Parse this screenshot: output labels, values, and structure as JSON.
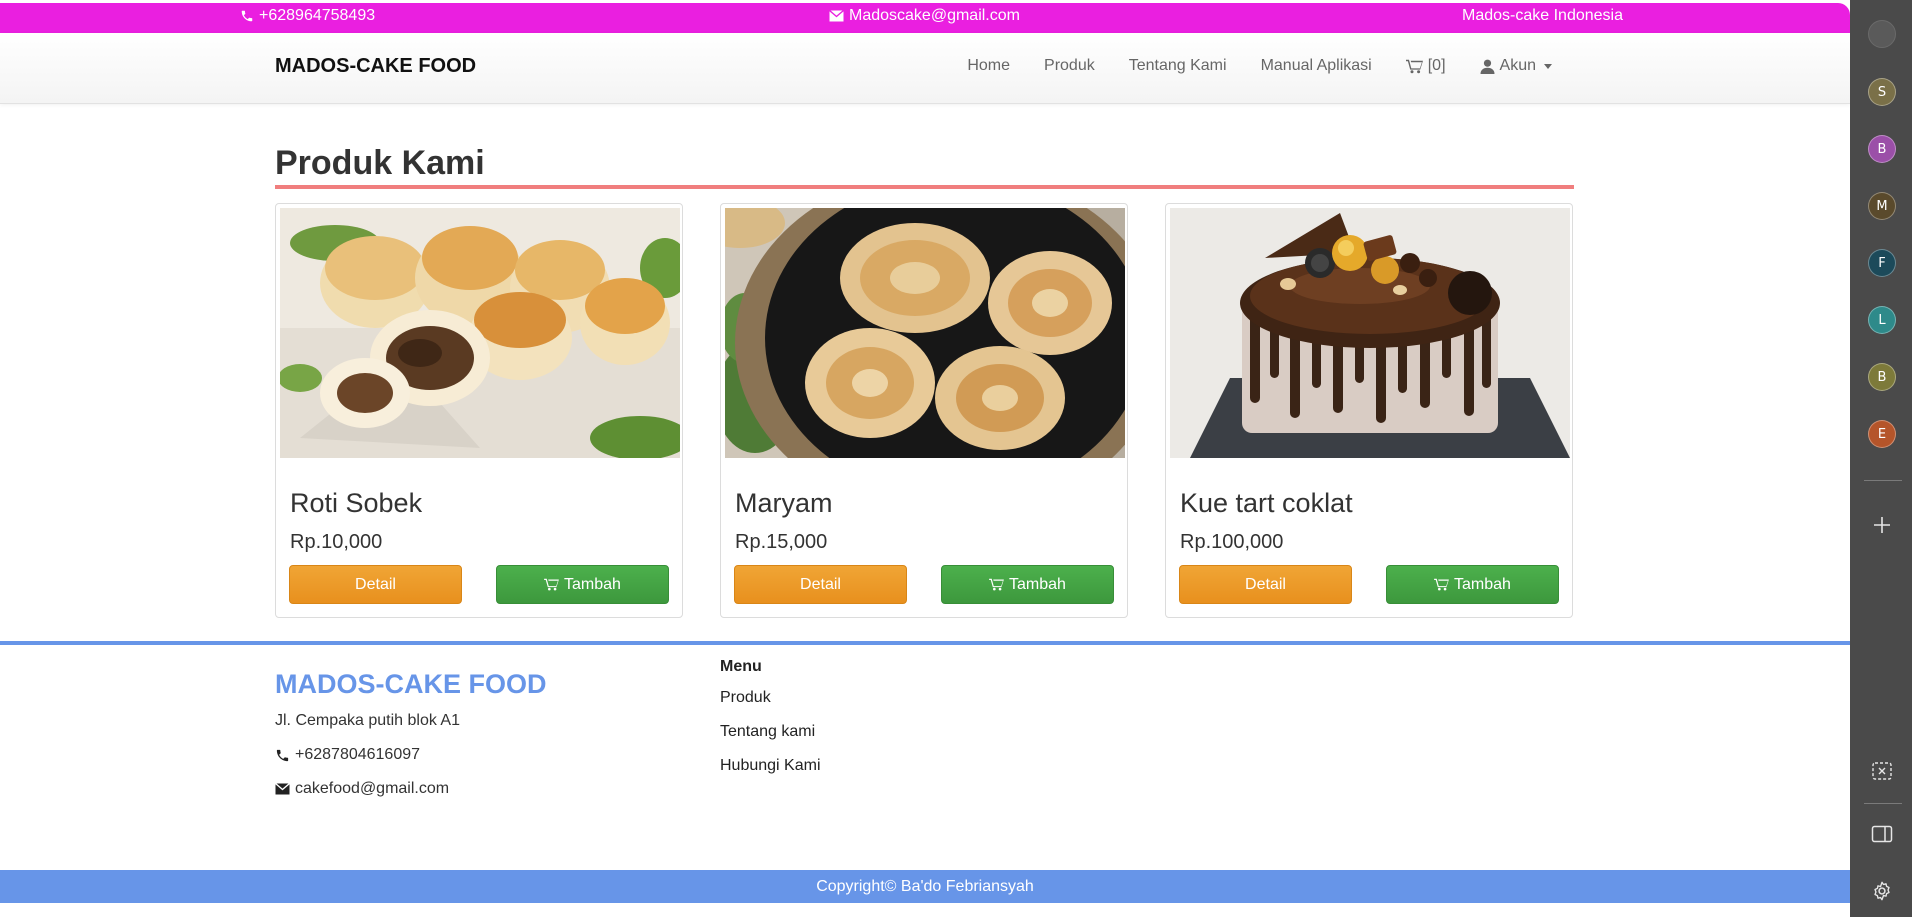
{
  "topbar": {
    "phone": "+628964758493",
    "email": "Madoscake@gmail.com",
    "tagline": "Mados-cake Indonesia"
  },
  "navbar": {
    "brand": "MADOS-CAKE FOOD",
    "links": [
      "Home",
      "Produk",
      "Tentang Kami",
      "Manual Aplikasi"
    ],
    "cart_count": "[0]",
    "account": "Akun"
  },
  "section": {
    "title": "Produk Kami"
  },
  "products": [
    {
      "name": "Roti Sobek",
      "price": "Rp.10,000",
      "detail_label": "Detail",
      "add_label": "Tambah"
    },
    {
      "name": "Maryam",
      "price": "Rp.15,000",
      "detail_label": "Detail",
      "add_label": "Tambah"
    },
    {
      "name": "Kue tart coklat",
      "price": "Rp.100,000",
      "detail_label": "Detail",
      "add_label": "Tambah"
    }
  ],
  "footer": {
    "brand": "MADOS-CAKE FOOD",
    "address": "Jl. Cempaka putih blok A1",
    "phone": "+6287804616097",
    "email": "cakefood@gmail.com",
    "menu_title": "Menu",
    "menu_items": [
      "Produk",
      "Tentang kami",
      "Hubungi Kami"
    ],
    "copyright": "Copyright© Ba'do Febriansyah"
  },
  "browser_sidebar": {
    "profiles": [
      {
        "letter": "S",
        "color": "#7a7048"
      },
      {
        "letter": "B",
        "color": "#9b4fa8"
      },
      {
        "letter": "M",
        "color": "#5a4a2c"
      },
      {
        "letter": "F",
        "color": "#1c4a5a"
      },
      {
        "letter": "L",
        "color": "#2e8a8a"
      },
      {
        "letter": "B",
        "color": "#7d7a3a"
      },
      {
        "letter": "E",
        "color": "#b5552a"
      }
    ],
    "icons": [
      "add-icon",
      "screenshot-icon",
      "panel-icon",
      "settings-icon"
    ]
  },
  "colors": {
    "topbar": "#ea1fe0",
    "accent_blue": "#6795e8",
    "heading_rule": "#f07e7e",
    "detail_button": "#e8901e",
    "add_button": "#3d983d"
  }
}
